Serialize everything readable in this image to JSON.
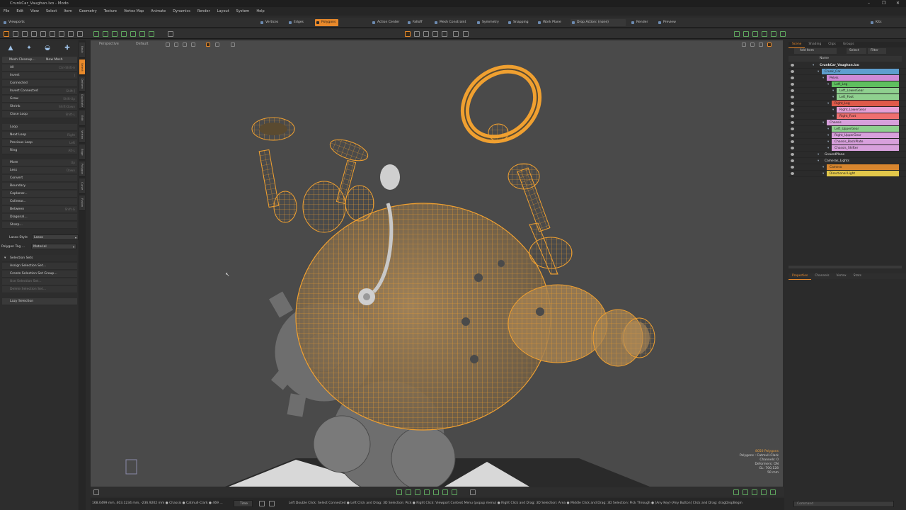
{
  "app": {
    "title": "CrunkCar_Vaughan.lxo - Modo",
    "window_controls": [
      "–",
      "❐",
      "✕"
    ]
  },
  "menu": [
    "File",
    "Edit",
    "View",
    "Select",
    "Item",
    "Geometry",
    "Texture",
    "Vertex Map",
    "Animate",
    "Dynamics",
    "Render",
    "Layout",
    "System",
    "Help"
  ],
  "modebar": {
    "viewports": "Viewports",
    "vertices": "Vertices",
    "edges": "Edges",
    "polygons": "Polygons",
    "action_center": "Action Center",
    "falloff": "Falloff",
    "mesh_constraint": "Mesh Constraint",
    "symmetry": "Symmetry",
    "snapping": "Snapping",
    "work_plane": "Work Plane",
    "drop_action": "Drop Action: (none)",
    "render": "Render",
    "preview": "Preview",
    "kits": "Kits"
  },
  "left_panel": {
    "mesh_cleanup": "Mesh Cleanup...",
    "new_mesh": "New Mesh",
    "items": [
      {
        "label": "All",
        "shortcut": "Ctrl-Shift-A"
      },
      {
        "label": "Invert",
        "shortcut": "]"
      },
      {
        "label": "Connected",
        "shortcut": ""
      },
      {
        "label": "Invert Connected",
        "shortcut": "Shift-]"
      },
      {
        "label": "Grow",
        "shortcut": "Shift-Up"
      },
      {
        "label": "Shrink",
        "shortcut": "Shift-Down"
      },
      {
        "label": "Close Loop",
        "shortcut": "Shift-L"
      }
    ],
    "items2": [
      {
        "label": "Loop",
        "shortcut": ""
      },
      {
        "label": "Next Loop",
        "shortcut": "Right"
      },
      {
        "label": "Previous Loop",
        "shortcut": "Left"
      },
      {
        "label": "Ring",
        "shortcut": "Alt-L"
      }
    ],
    "items3": [
      {
        "label": "More",
        "shortcut": "Up"
      },
      {
        "label": "Less",
        "shortcut": "Down"
      },
      {
        "label": "Convert",
        "shortcut": ""
      },
      {
        "label": "Boundary",
        "shortcut": ""
      },
      {
        "label": "Coplanar...",
        "shortcut": ""
      },
      {
        "label": "Colinear...",
        "shortcut": ""
      },
      {
        "label": "Between",
        "shortcut": "Shift-G"
      },
      {
        "label": "Diagonal...",
        "shortcut": ""
      },
      {
        "label": "Sharp...",
        "shortcut": ""
      }
    ],
    "lasso_style_label": "Lasso Style",
    "lasso_style_value": "Lasso",
    "polygon_tag_label": "Polygon Tag ...",
    "polygon_tag_value": "Material",
    "selection_sets": "Selection Sets",
    "sets_items": [
      {
        "label": "Assign Selection Set...",
        "dim": false
      },
      {
        "label": "Create Selection Set Group...",
        "dim": false
      },
      {
        "label": "Use Selection Set...",
        "dim": true
      },
      {
        "label": "Delete Selection Set...",
        "dim": true
      }
    ],
    "lazy_selection": "Lazy Selection"
  },
  "vertical_tabs": [
    "Basic",
    "Select",
    "Deform",
    "Duplicate",
    "Edit",
    "Vertex",
    "Edge",
    "Polygon",
    "Curve",
    "Fusion"
  ],
  "viewport": {
    "view_label": "Perspective",
    "style_label": "Default",
    "info": {
      "count": "8050 Polygons",
      "mode": "Polygons : Catmull-Clark",
      "channels": "Channels: 0",
      "deformers": "Deformers: ON",
      "gl": "GL: 700,128",
      "lens": "50 mm"
    }
  },
  "scene": {
    "tabs": [
      "Scene",
      "Shading",
      "Clips",
      "Groups"
    ],
    "toolbar": {
      "add_item": "Add Item",
      "select": "Select",
      "filter": "Filter"
    },
    "header": "Name",
    "rows": [
      {
        "name": "CrunkCar_Vaughan.lxo",
        "indent": 0,
        "color": ""
      },
      {
        "name": "Crunk_Car",
        "indent": 1,
        "color": "#5f9fcf"
      },
      {
        "name": "Pelvis",
        "indent": 2,
        "color": "#cf8ad6"
      },
      {
        "name": "Left_Leg",
        "indent": 3,
        "color": "#5fbf5f"
      },
      {
        "name": "Left_LowerGear",
        "indent": 4,
        "color": "#8fd08f"
      },
      {
        "name": "Left_Foot",
        "indent": 4,
        "color": "#8fd08f"
      },
      {
        "name": "Right_Leg",
        "indent": 3,
        "color": "#df5a4a"
      },
      {
        "name": "Right_LowerGear",
        "indent": 4,
        "color": "#e6a0d6"
      },
      {
        "name": "Right_Foot",
        "indent": 4,
        "color": "#ef6f6f"
      },
      {
        "name": "Chassis",
        "indent": 2,
        "color": "#d8a0dc"
      },
      {
        "name": "Left_UpperGear",
        "indent": 3,
        "color": "#8fd08f"
      },
      {
        "name": "Right_UpperGear",
        "indent": 3,
        "color": "#d8a0dc"
      },
      {
        "name": "Chassis_BackPlate",
        "indent": 3,
        "color": "#d8a0dc"
      },
      {
        "name": "Chassis_Shifter",
        "indent": 3,
        "color": "#d8a0dc"
      },
      {
        "name": "GroundPlane",
        "indent": 1,
        "color": ""
      },
      {
        "name": "Cameras_Lights",
        "indent": 1,
        "color": ""
      },
      {
        "name": "Camera",
        "indent": 2,
        "color": "#d8862e"
      },
      {
        "name": "Directional Light",
        "indent": 2,
        "color": "#e3c84a"
      }
    ]
  },
  "properties_tabs": [
    "Properties",
    "Channels",
    "Vertex",
    "Stats"
  ],
  "statusbar": {
    "coords": "168.0499 mm, 403.1234 mm, -236.9202 mm  ● Chassis ● Catmull-Clark ● 469 ...",
    "time": "Time",
    "hints": "Left Double Click: Select Connected ● Left Click and Drag: 3D Selection: Pick ● Right Click: Viewport Context Menu (popup menu) ● Right Click and Drag: 3D Selection: Area ● Middle Click and Drag: 3D Selection: Pick Through ● [Any Key]-[Any Button] Click and Drag: dragDropBegin",
    "command_placeholder": "Command"
  },
  "colors": {
    "accent": "#e8892b",
    "wire": "#f0a030",
    "gear": "#6e6e6e"
  }
}
